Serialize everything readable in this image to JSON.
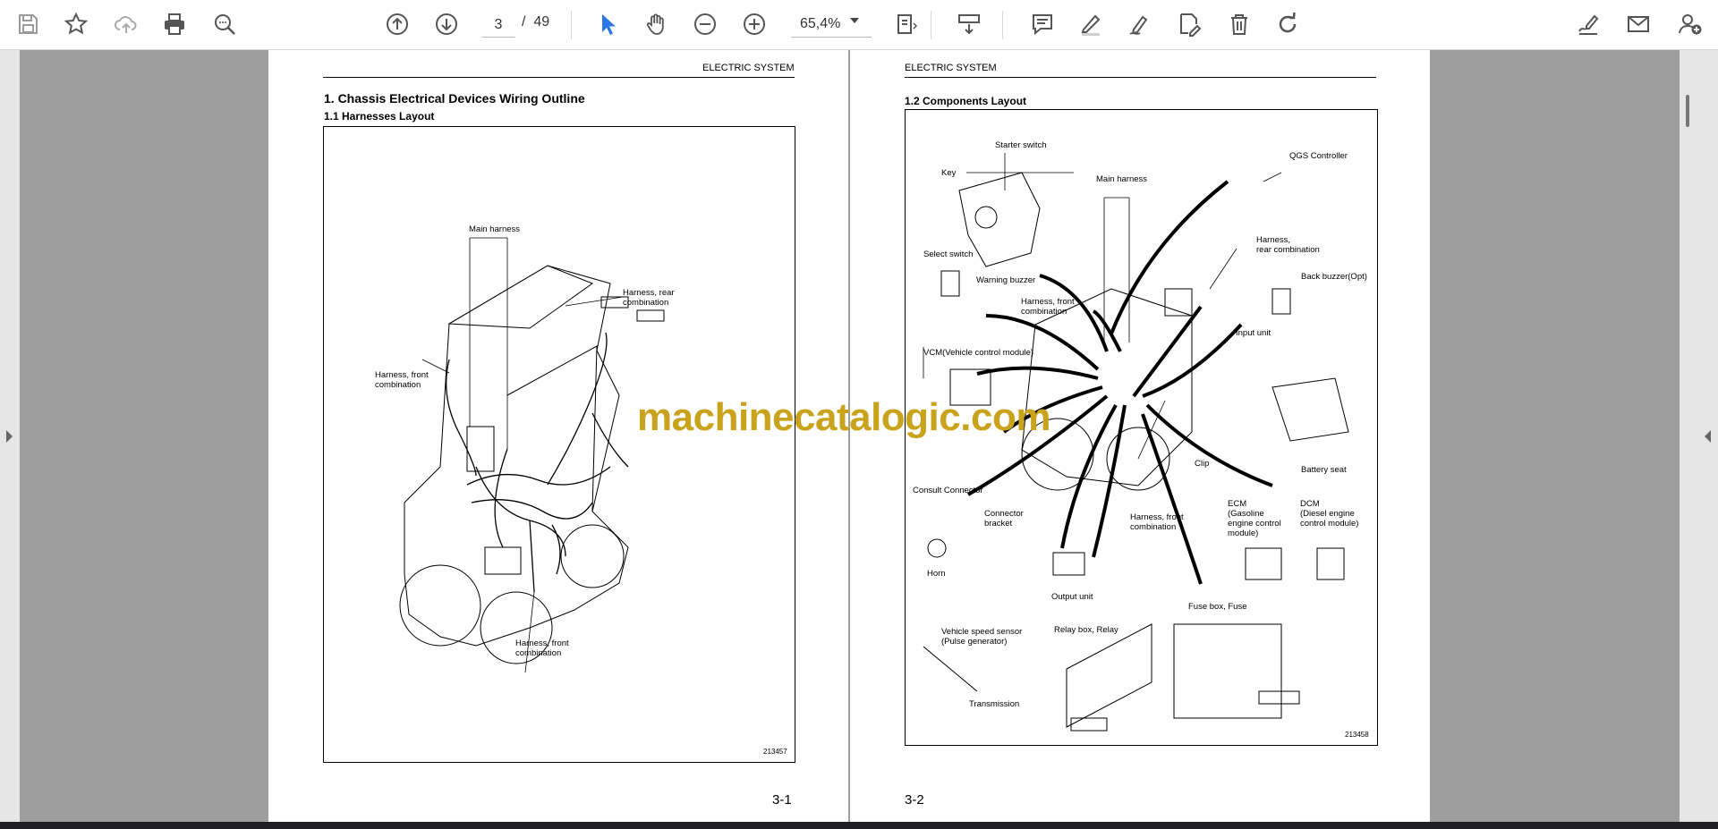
{
  "toolbar": {
    "page_current": "3",
    "page_total": "49",
    "page_separator": "/",
    "zoom": "65,4%"
  },
  "left_page": {
    "header": "ELECTRIC SYSTEM",
    "title": "1.  Chassis Electrical Devices Wiring Outline",
    "subtitle": "1.1   Harnesses Layout",
    "labels": {
      "main_harness": "Main harness",
      "harness_rear": "Harness, rear\ncombination",
      "harness_front_upper": "Harness, front\ncombination",
      "harness_front_lower": "Harness, front\ncombination"
    },
    "figure_number": "213457",
    "page_number": "3-1"
  },
  "right_page": {
    "header": "ELECTRIC SYSTEM",
    "subtitle": "1.2   Components Layout",
    "labels": {
      "starter_switch": "Starter switch",
      "key": "Key",
      "main_harness": "Main harness",
      "qgs_controller": "QGS Controller",
      "harness_rear": "Harness,\nrear combination",
      "select_switch": "Select switch",
      "warning_buzzer": "Warning buzzer",
      "harness_front_upper": "Harness, front\ncombination",
      "back_buzzer": "Back buzzer(Opt)",
      "input_unit": "Input unit",
      "vcm": "VCM(Vehicle control module)",
      "battery_seat": "Battery seat",
      "clip": "Clip",
      "consult_connector": "Consult Connector",
      "connector_bracket": "Connector\nbracket",
      "harness_front_lower": "Harness, front\ncombination",
      "ecm": "ECM\n(Gasoline\nengine control\nmodule)",
      "dcm": "DCM\n(Diesel engine\ncontrol module)",
      "horn": "Horn",
      "output_unit": "Output unit",
      "fuse_box": "Fuse box, Fuse",
      "vehicle_speed_sensor": "Vehicle speed sensor\n(Pulse generator)",
      "relay_box": "Relay box, Relay",
      "transmission": "Transmission"
    },
    "figure_number": "213458",
    "page_number": "3-2"
  },
  "watermark": "machinecatalogic.com",
  "colors": {
    "accent_blue": "#2b78e4",
    "icon_gray": "#555555",
    "watermark": "#c9a31c"
  }
}
